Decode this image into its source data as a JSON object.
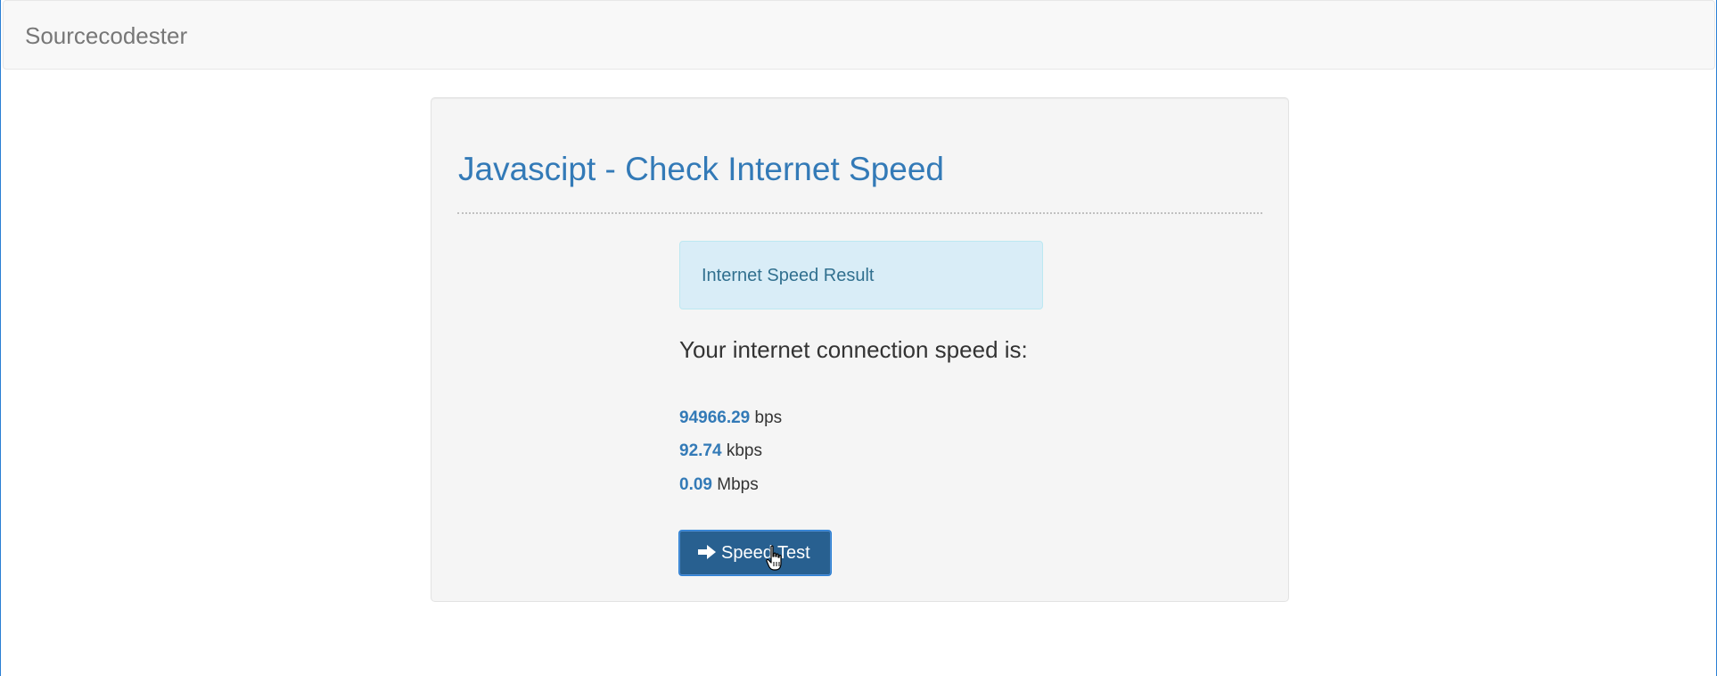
{
  "navbar": {
    "brand": "Sourcecodester"
  },
  "panel": {
    "title": "Javascipt - Check Internet Speed",
    "alert": "Internet Speed Result",
    "lead": "Your internet connection speed is:",
    "speeds": [
      {
        "value": "94966.29",
        "unit": "bps"
      },
      {
        "value": "92.74",
        "unit": "kbps"
      },
      {
        "value": "0.09",
        "unit": "Mbps"
      }
    ],
    "button": {
      "label": "Speed Test",
      "icon": "arrow-right-icon"
    }
  },
  "cursor": {
    "icon": "hand-pointer-icon"
  },
  "colors": {
    "brand_text": "#777777",
    "title": "#337ab7",
    "alert_bg": "#d9edf7",
    "alert_text": "#31708f",
    "button_bg": "#286090",
    "speed_value": "#337ab7"
  }
}
